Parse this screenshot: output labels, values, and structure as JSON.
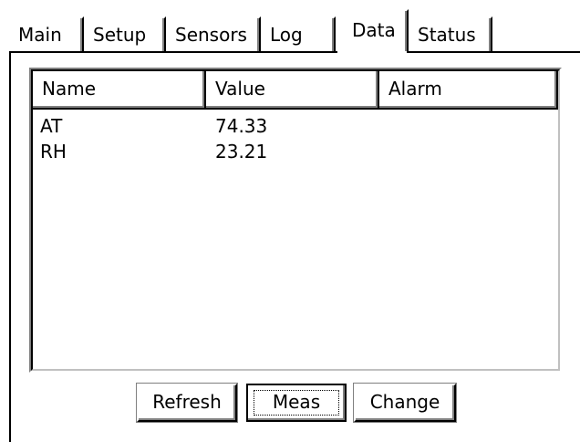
{
  "tabs": [
    {
      "label": "Main",
      "active": false
    },
    {
      "label": "Setup",
      "active": false
    },
    {
      "label": "Sensors",
      "active": false
    },
    {
      "label": "Log",
      "active": false
    },
    {
      "label": "Data",
      "active": true
    },
    {
      "label": "Status",
      "active": false
    }
  ],
  "list": {
    "columns": [
      "Name",
      "Value",
      "Alarm"
    ],
    "rows": [
      {
        "name": "AT",
        "value": "74.33",
        "alarm": ""
      },
      {
        "name": "RH",
        "value": "23.21",
        "alarm": ""
      }
    ]
  },
  "buttons": {
    "refresh": "Refresh",
    "meas": "Meas",
    "change": "Change"
  }
}
